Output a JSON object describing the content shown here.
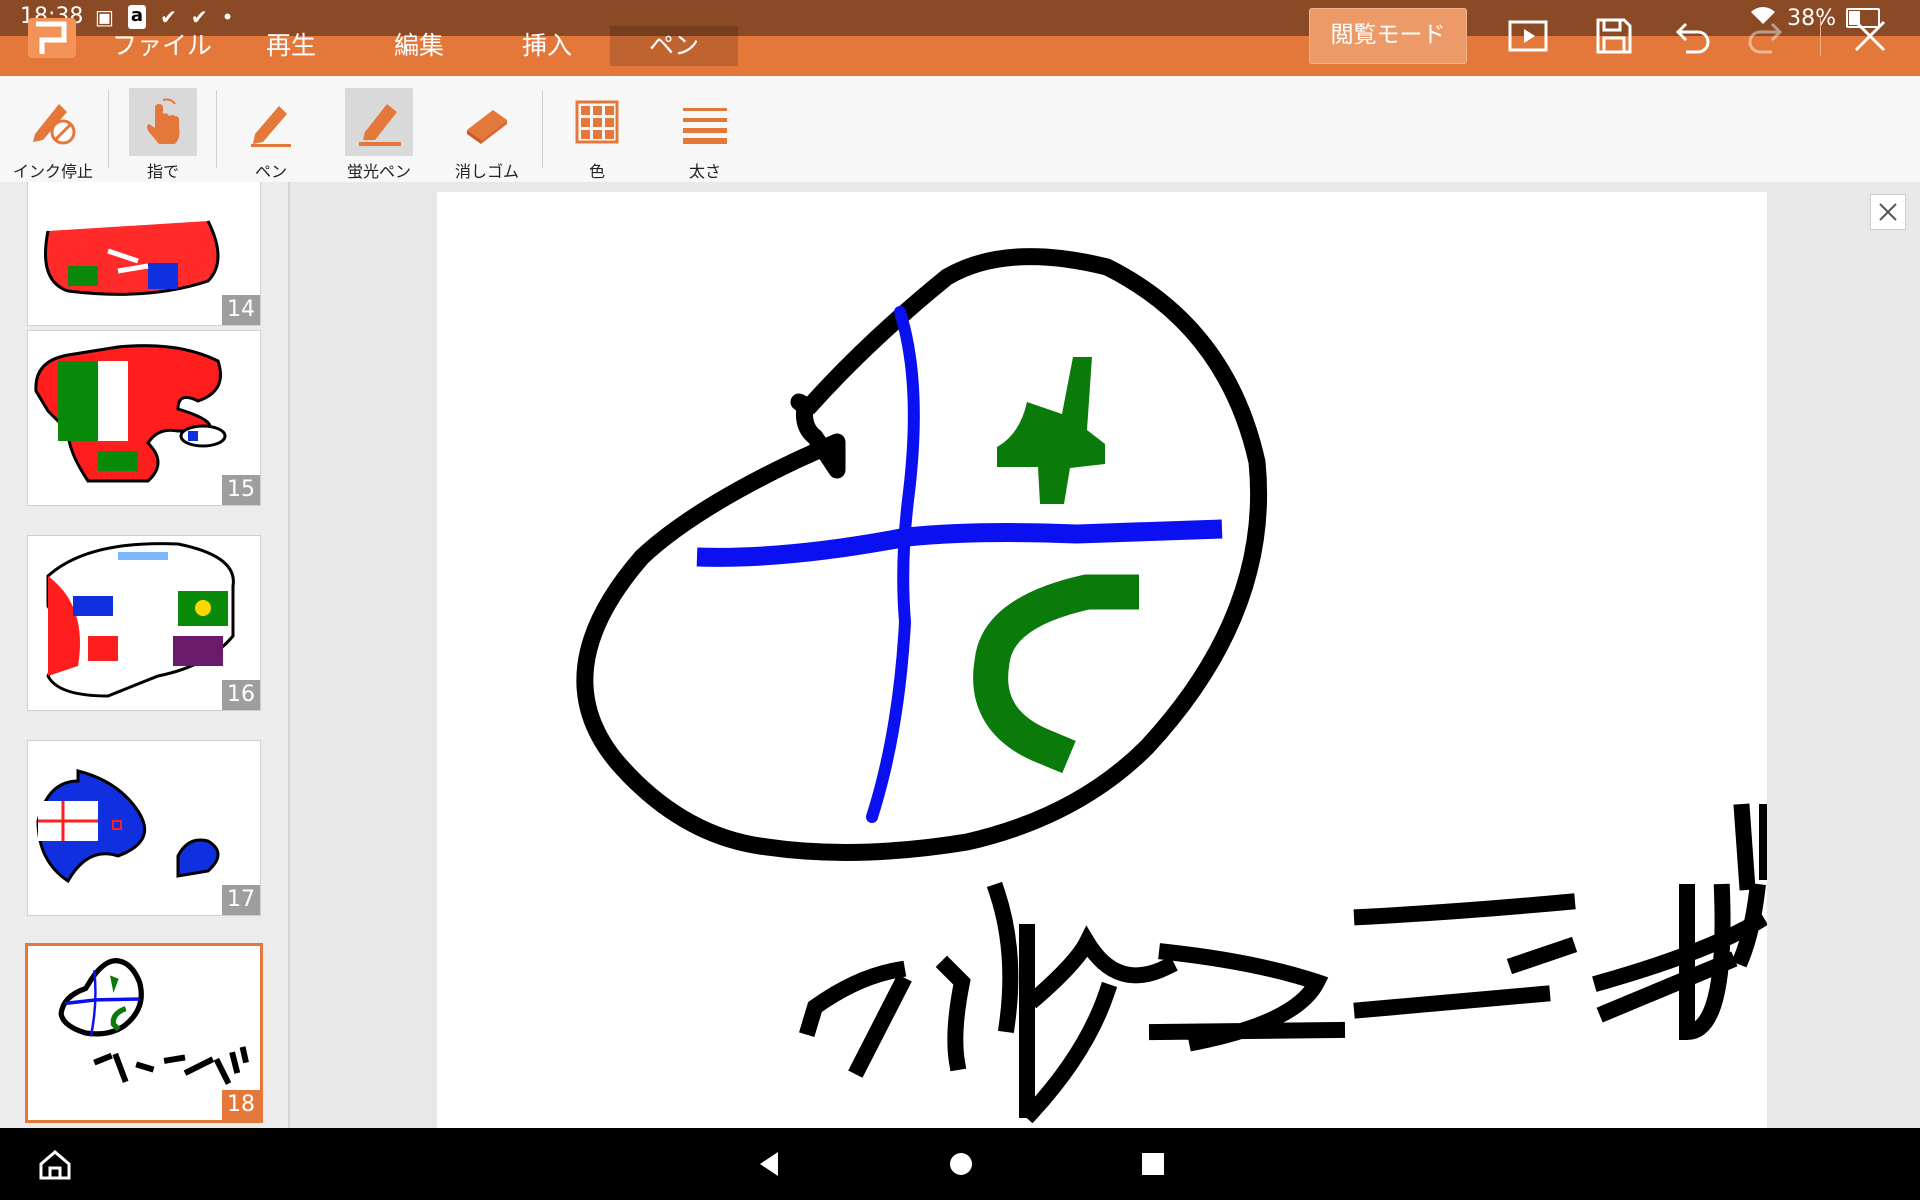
{
  "status_bar": {
    "time": "18:38",
    "battery": "38%",
    "battery_level": 0.38,
    "notification_icons": [
      "image-icon",
      "amazon-icon",
      "check-icon",
      "check-icon",
      "dot-icon"
    ]
  },
  "menu": {
    "items": [
      {
        "label": "ファイル"
      },
      {
        "label": "再生"
      },
      {
        "label": "編集"
      },
      {
        "label": "挿入"
      },
      {
        "label": "ペン",
        "active": true
      }
    ],
    "reading_mode": "閲覧モード",
    "actions": [
      "slideshow-icon",
      "save-icon",
      "undo-icon",
      "redo-icon",
      "close-icon"
    ]
  },
  "ribbon": {
    "tools": [
      {
        "label": "インク停止",
        "icon": "ink-stop-icon"
      },
      {
        "label": "指で",
        "icon": "finger-icon",
        "active": true
      },
      {
        "label": "ペン",
        "icon": "pen-icon"
      },
      {
        "label": "蛍光ペン",
        "icon": "highlighter-icon",
        "active": true
      },
      {
        "label": "消しゴム",
        "icon": "eraser-icon"
      },
      {
        "label": "色",
        "icon": "color-grid-icon"
      },
      {
        "label": "太さ",
        "icon": "thickness-icon"
      }
    ]
  },
  "slides": {
    "numbers": [
      "14",
      "15",
      "16",
      "17",
      "18"
    ],
    "selected": "18"
  },
  "colors": {
    "accent": "#e4783b",
    "status_bar": "#8b4a26",
    "ink_black": "#000000",
    "ink_blue": "#0a10f0",
    "ink_green": "#0a7a0a",
    "ink_red": "#ff0000"
  }
}
